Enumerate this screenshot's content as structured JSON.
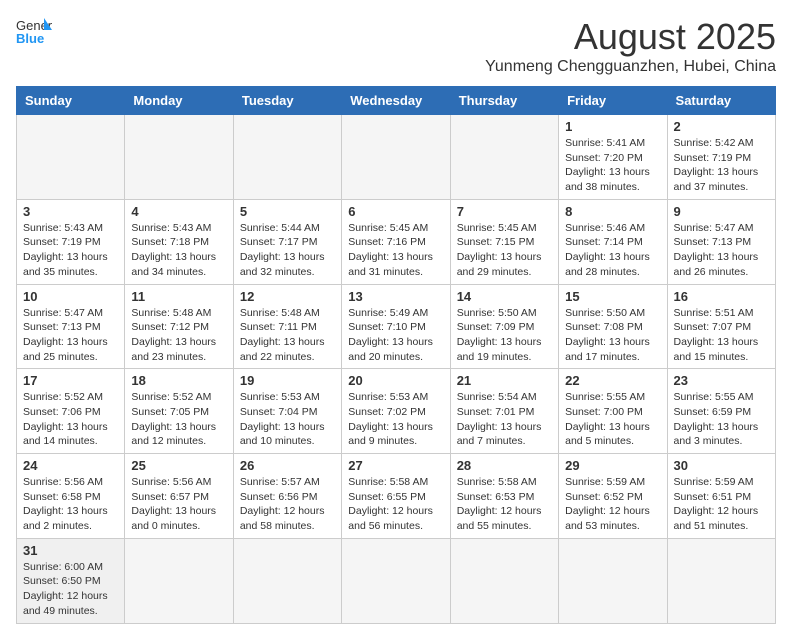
{
  "header": {
    "logo_line1": "General",
    "logo_line2": "Blue",
    "title": "August 2025",
    "subtitle": "Yunmeng Chengguanzhen, Hubei, China"
  },
  "weekdays": [
    "Sunday",
    "Monday",
    "Tuesday",
    "Wednesday",
    "Thursday",
    "Friday",
    "Saturday"
  ],
  "weeks": [
    [
      {
        "day": "",
        "info": ""
      },
      {
        "day": "",
        "info": ""
      },
      {
        "day": "",
        "info": ""
      },
      {
        "day": "",
        "info": ""
      },
      {
        "day": "",
        "info": ""
      },
      {
        "day": "1",
        "info": "Sunrise: 5:41 AM\nSunset: 7:20 PM\nDaylight: 13 hours and 38 minutes."
      },
      {
        "day": "2",
        "info": "Sunrise: 5:42 AM\nSunset: 7:19 PM\nDaylight: 13 hours and 37 minutes."
      }
    ],
    [
      {
        "day": "3",
        "info": "Sunrise: 5:43 AM\nSunset: 7:19 PM\nDaylight: 13 hours and 35 minutes."
      },
      {
        "day": "4",
        "info": "Sunrise: 5:43 AM\nSunset: 7:18 PM\nDaylight: 13 hours and 34 minutes."
      },
      {
        "day": "5",
        "info": "Sunrise: 5:44 AM\nSunset: 7:17 PM\nDaylight: 13 hours and 32 minutes."
      },
      {
        "day": "6",
        "info": "Sunrise: 5:45 AM\nSunset: 7:16 PM\nDaylight: 13 hours and 31 minutes."
      },
      {
        "day": "7",
        "info": "Sunrise: 5:45 AM\nSunset: 7:15 PM\nDaylight: 13 hours and 29 minutes."
      },
      {
        "day": "8",
        "info": "Sunrise: 5:46 AM\nSunset: 7:14 PM\nDaylight: 13 hours and 28 minutes."
      },
      {
        "day": "9",
        "info": "Sunrise: 5:47 AM\nSunset: 7:13 PM\nDaylight: 13 hours and 26 minutes."
      }
    ],
    [
      {
        "day": "10",
        "info": "Sunrise: 5:47 AM\nSunset: 7:13 PM\nDaylight: 13 hours and 25 minutes."
      },
      {
        "day": "11",
        "info": "Sunrise: 5:48 AM\nSunset: 7:12 PM\nDaylight: 13 hours and 23 minutes."
      },
      {
        "day": "12",
        "info": "Sunrise: 5:48 AM\nSunset: 7:11 PM\nDaylight: 13 hours and 22 minutes."
      },
      {
        "day": "13",
        "info": "Sunrise: 5:49 AM\nSunset: 7:10 PM\nDaylight: 13 hours and 20 minutes."
      },
      {
        "day": "14",
        "info": "Sunrise: 5:50 AM\nSunset: 7:09 PM\nDaylight: 13 hours and 19 minutes."
      },
      {
        "day": "15",
        "info": "Sunrise: 5:50 AM\nSunset: 7:08 PM\nDaylight: 13 hours and 17 minutes."
      },
      {
        "day": "16",
        "info": "Sunrise: 5:51 AM\nSunset: 7:07 PM\nDaylight: 13 hours and 15 minutes."
      }
    ],
    [
      {
        "day": "17",
        "info": "Sunrise: 5:52 AM\nSunset: 7:06 PM\nDaylight: 13 hours and 14 minutes."
      },
      {
        "day": "18",
        "info": "Sunrise: 5:52 AM\nSunset: 7:05 PM\nDaylight: 13 hours and 12 minutes."
      },
      {
        "day": "19",
        "info": "Sunrise: 5:53 AM\nSunset: 7:04 PM\nDaylight: 13 hours and 10 minutes."
      },
      {
        "day": "20",
        "info": "Sunrise: 5:53 AM\nSunset: 7:02 PM\nDaylight: 13 hours and 9 minutes."
      },
      {
        "day": "21",
        "info": "Sunrise: 5:54 AM\nSunset: 7:01 PM\nDaylight: 13 hours and 7 minutes."
      },
      {
        "day": "22",
        "info": "Sunrise: 5:55 AM\nSunset: 7:00 PM\nDaylight: 13 hours and 5 minutes."
      },
      {
        "day": "23",
        "info": "Sunrise: 5:55 AM\nSunset: 6:59 PM\nDaylight: 13 hours and 3 minutes."
      }
    ],
    [
      {
        "day": "24",
        "info": "Sunrise: 5:56 AM\nSunset: 6:58 PM\nDaylight: 13 hours and 2 minutes."
      },
      {
        "day": "25",
        "info": "Sunrise: 5:56 AM\nSunset: 6:57 PM\nDaylight: 13 hours and 0 minutes."
      },
      {
        "day": "26",
        "info": "Sunrise: 5:57 AM\nSunset: 6:56 PM\nDaylight: 12 hours and 58 minutes."
      },
      {
        "day": "27",
        "info": "Sunrise: 5:58 AM\nSunset: 6:55 PM\nDaylight: 12 hours and 56 minutes."
      },
      {
        "day": "28",
        "info": "Sunrise: 5:58 AM\nSunset: 6:53 PM\nDaylight: 12 hours and 55 minutes."
      },
      {
        "day": "29",
        "info": "Sunrise: 5:59 AM\nSunset: 6:52 PM\nDaylight: 12 hours and 53 minutes."
      },
      {
        "day": "30",
        "info": "Sunrise: 5:59 AM\nSunset: 6:51 PM\nDaylight: 12 hours and 51 minutes."
      }
    ],
    [
      {
        "day": "31",
        "info": "Sunrise: 6:00 AM\nSunset: 6:50 PM\nDaylight: 12 hours and 49 minutes."
      },
      {
        "day": "",
        "info": ""
      },
      {
        "day": "",
        "info": ""
      },
      {
        "day": "",
        "info": ""
      },
      {
        "day": "",
        "info": ""
      },
      {
        "day": "",
        "info": ""
      },
      {
        "day": "",
        "info": ""
      }
    ]
  ]
}
